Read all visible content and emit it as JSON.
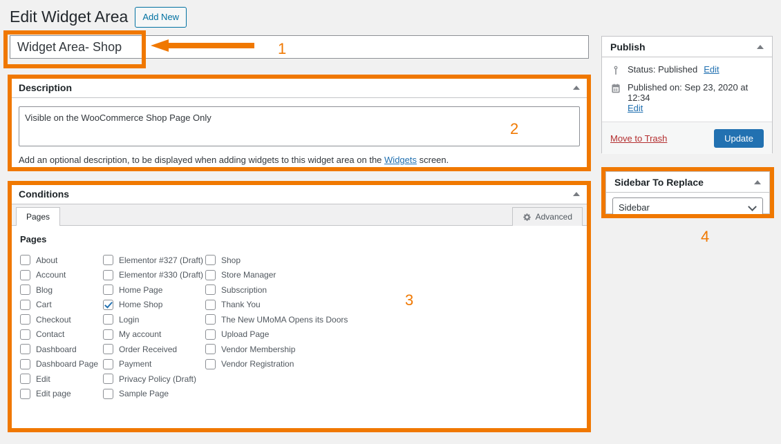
{
  "header": {
    "page_title": "Edit Widget Area",
    "add_new_label": "Add New"
  },
  "title_field": {
    "value": "Widget Area- Shop"
  },
  "description_panel": {
    "heading": "Description",
    "textarea_value": "Visible on the WooCommerce Shop Page Only",
    "hint_before": "Add an optional description, to be displayed when adding widgets to this widget area on the ",
    "hint_link": "Widgets",
    "hint_after": " screen."
  },
  "conditions_panel": {
    "heading": "Conditions",
    "tab_pages": "Pages",
    "tab_advanced": "Advanced",
    "group_title": "Pages",
    "columns": [
      [
        {
          "label": "About",
          "checked": false
        },
        {
          "label": "Account",
          "checked": false
        },
        {
          "label": "Blog",
          "checked": false
        },
        {
          "label": "Cart",
          "checked": false
        },
        {
          "label": "Checkout",
          "checked": false
        },
        {
          "label": "Contact",
          "checked": false
        },
        {
          "label": "Dashboard",
          "checked": false
        },
        {
          "label": "Dashboard Page",
          "checked": false
        },
        {
          "label": "Edit",
          "checked": false
        },
        {
          "label": "Edit page",
          "checked": false
        }
      ],
      [
        {
          "label": "Elementor #327 (Draft)",
          "checked": false
        },
        {
          "label": "Elementor #330 (Draft)",
          "checked": false
        },
        {
          "label": "Home Page",
          "checked": false
        },
        {
          "label": "Home Shop",
          "checked": true
        },
        {
          "label": "Login",
          "checked": false
        },
        {
          "label": "My account",
          "checked": false
        },
        {
          "label": "Order Received",
          "checked": false
        },
        {
          "label": "Payment",
          "checked": false
        },
        {
          "label": "Privacy Policy (Draft)",
          "checked": false
        },
        {
          "label": "Sample Page",
          "checked": false
        }
      ],
      [
        {
          "label": "Shop",
          "checked": false
        },
        {
          "label": "Store Manager",
          "checked": false
        },
        {
          "label": "Subscription",
          "checked": false
        },
        {
          "label": "Thank You",
          "checked": false
        },
        {
          "label": "The New UMoMA Opens its Doors",
          "checked": false
        },
        {
          "label": "Upload Page",
          "checked": false
        },
        {
          "label": "Vendor Membership",
          "checked": false
        },
        {
          "label": "Vendor Registration",
          "checked": false
        }
      ]
    ]
  },
  "publish_panel": {
    "heading": "Publish",
    "status_label": "Status: Published",
    "status_edit": "Edit",
    "published_on_label": "Published on: Sep 23, 2020 at 12:34",
    "published_edit": "Edit",
    "move_to_trash": "Move to Trash",
    "update_label": "Update"
  },
  "sidebar_replace_panel": {
    "heading": "Sidebar To Replace",
    "selected_option": "Sidebar",
    "options": [
      "Sidebar"
    ]
  },
  "annotations": {
    "color": "#f07800",
    "markers": [
      "1",
      "2",
      "3",
      "4"
    ]
  }
}
